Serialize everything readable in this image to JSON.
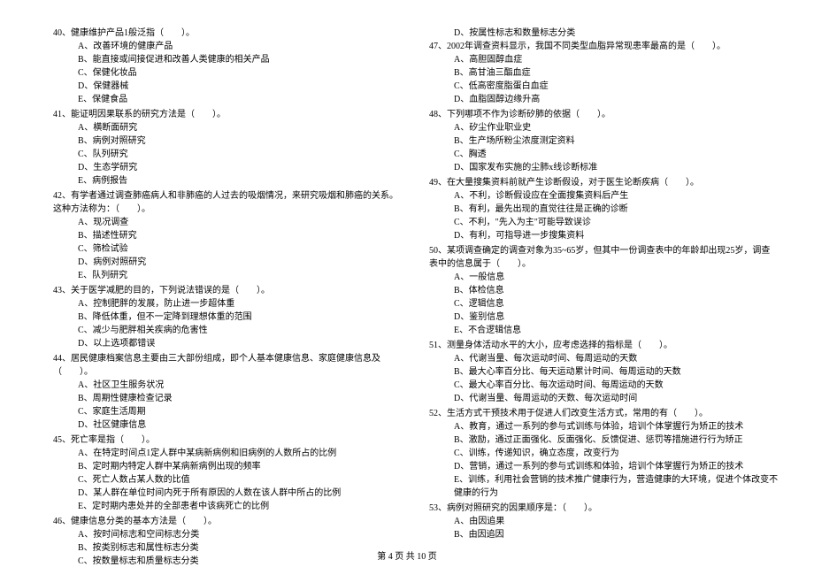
{
  "left": {
    "q40": {
      "title": "40、健康维护产品1般泛指（　　）。",
      "opts": [
        "A、改善环境的健康产品",
        "B、能直接或间接促进和改善人类健康的相关产品",
        "C、保健化妆品",
        "D、保健器械",
        "E、保健食品"
      ]
    },
    "q41": {
      "title": "41、能证明因果联系的研究方法是（　　）。",
      "opts": [
        "A、横断面研究",
        "B、病例对照研究",
        "C、队列研究",
        "D、生态学研究",
        "E、病例报告"
      ]
    },
    "q42": {
      "title": "42、有学者通过调查肺癌病人和非肺癌的人过去的吸烟情况，来研究吸烟和肺癌的关系。这种方法称为：（　　）。",
      "opts": [
        "A、现况调查",
        "B、描述性研究",
        "C、筛检试验",
        "D、病例对照研究",
        "E、队列研究"
      ]
    },
    "q43": {
      "title": "43、关于医学减肥的目的，下列说法错误的是（　　）。",
      "opts": [
        "A、控制肥胖的发展，防止进一步超体重",
        "B、降低体重，但不一定降到理想体重的范围",
        "C、减少与肥胖相关疾病的危害性",
        "D、以上选项都错误"
      ]
    },
    "q44": {
      "title": "44、居民健康档案信息主要由三大部份组成，即个人基本健康信息、家庭健康信息及（　　）。",
      "opts": [
        "A、社区卫生服务状况",
        "B、周期性健康检查记录",
        "C、家庭生活周期",
        "D、社区健康信息"
      ]
    },
    "q45": {
      "title": "45、死亡率是指（　　）。",
      "opts": [
        "A、在特定时间点1定人群中某病新病例和旧病例的人数所占的比例",
        "B、定时期内特定人群中某病新病例出现的频率",
        "C、死亡人数占某人数的比值",
        "D、某人群在单位时间内死于所有原因的人数在该人群中所占的比例",
        "E、定时期内患处并的全部患者中该病死亡的比例"
      ]
    },
    "q46": {
      "title": "46、健康信息分类的基本方法是（　　）。",
      "opts": [
        "A、按时间标志和空间标志分类",
        "B、按类别标志和属性标志分类",
        "C、按数量标志和质量标志分类"
      ]
    }
  },
  "right": {
    "q46d": "D、按属性标志和数量标志分类",
    "q47": {
      "title": "47、2002年调查资料显示，我国不同类型血脂异常现患率最高的是（　　）。",
      "opts": [
        "A、高胆固醇血症",
        "B、高甘油三酯血症",
        "C、低高密度脂蛋白血症",
        "D、血脂固醇边缘升高"
      ]
    },
    "q48": {
      "title": "48、下列哪项不作为诊断矽肺的依据（　　）。",
      "opts": [
        "A、矽尘作业职业史",
        "B、生产场所粉尘浓度测定资料",
        "C、胸透",
        "D、国家发布实施的尘肺x线诊断标准"
      ]
    },
    "q49": {
      "title": "49、在大量搜集资料前就产生诊断假设，对于医生论断疾病（　　）。",
      "opts": [
        "A、不利，诊断假设应在全面搜集资料后产生",
        "B、有利，最先出现的直觉往往是正确的诊断",
        "C、不利，\"先入为主\"可能导致误诊",
        "D、有利，可指导进一步搜集资料"
      ]
    },
    "q50": {
      "title": "50、某项调查确定的调查对象为35~65岁，但其中一份调查表中的年龄却出现25岁，调查表中的信息属于（　　）。",
      "opts": [
        "A、一般信息",
        "B、体检信息",
        "C、逻辑信息",
        "D、鉴别信息",
        "E、不合逻辑信息"
      ]
    },
    "q51": {
      "title": "51、测量身体活动水平的大小，应考虑选择的指标是（　　）。",
      "opts": [
        "A、代谢当量、每次运动时间、每周运动的天数",
        "B、最大心率百分比、每天运动累计时间、每周运动的天数",
        "C、最大心率百分比、每次运动时间、每周运动的天数",
        "D、代谢当量、每周运动的天数、每次运动时间"
      ]
    },
    "q52": {
      "title": "52、生活方式干预技术用于促进人们改变生活方式，常用的有（　　）。",
      "opts": [
        "A、教育，通过一系列的参与式训练与体验，培训个体掌握行为矫正的技术",
        "B、激励，通过正面强化、反面强化、反馈促进、惩罚等措施进行行为矫正",
        "C、训练，传递知识，确立态度，改变行为",
        "D、营销，通过一系列的参与式训练和体验，培训个体掌握行为矫正的技术",
        "E、训练，利用社会营销的技术推广健康行为，营造健康的大环境，促进个体改变不健康的行为"
      ]
    },
    "q53": {
      "title": "53、病例对照研究的因果顺序是：（　　）。",
      "opts": [
        "A、由因追果",
        "B、由因追因"
      ]
    }
  },
  "footer": "第 4 页 共 10 页"
}
